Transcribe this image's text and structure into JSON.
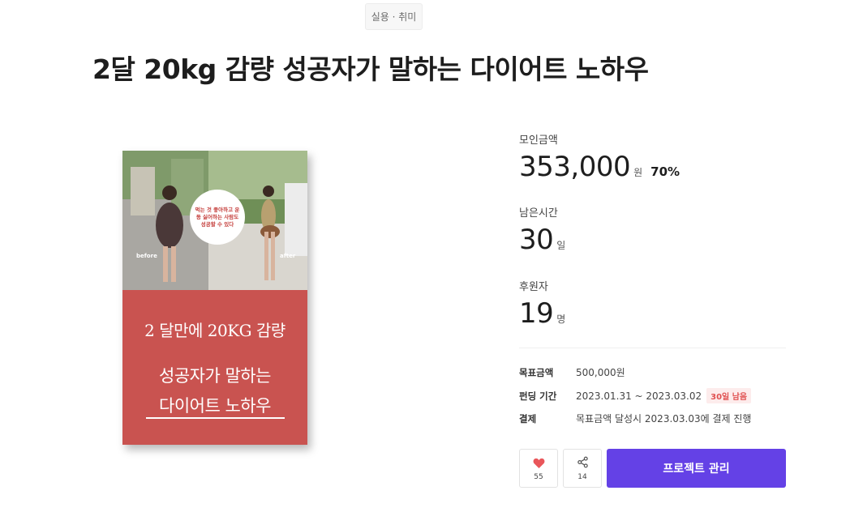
{
  "category": "실용 · 취미",
  "title": "2달 20kg 감량 성공자가 말하는 다이어트 노하우",
  "cover": {
    "bubble_text": "먹는 것 좋아하고 운동 싫어하는 사람도 성공할 수 있다",
    "before_label": "before",
    "after_label": "after",
    "line1": "2 달만에 20KG 감량",
    "line2": "성공자가 말하는",
    "line3": "다이어트 노하우",
    "bg_color": "#c95350"
  },
  "stats": {
    "raised_label": "모인금액",
    "raised_value": "353,000",
    "raised_unit": "원",
    "raised_percent": "70%",
    "time_label": "남은시간",
    "time_value": "30",
    "time_unit": "일",
    "backers_label": "후원자",
    "backers_value": "19",
    "backers_unit": "명"
  },
  "info": {
    "goal_key": "목표금액",
    "goal_val": "500,000원",
    "period_key": "펀딩 기간",
    "period_val": "2023.01.31 ~ 2023.03.02",
    "period_badge": "30일 남음",
    "payment_key": "결제",
    "payment_val": "목표금액 달성시 2023.03.03에 결제 진행"
  },
  "actions": {
    "like_count": "55",
    "share_count": "14",
    "manage_label": "프로젝트 관리",
    "accent": "#6441e6",
    "heart_color": "#e9565a"
  }
}
